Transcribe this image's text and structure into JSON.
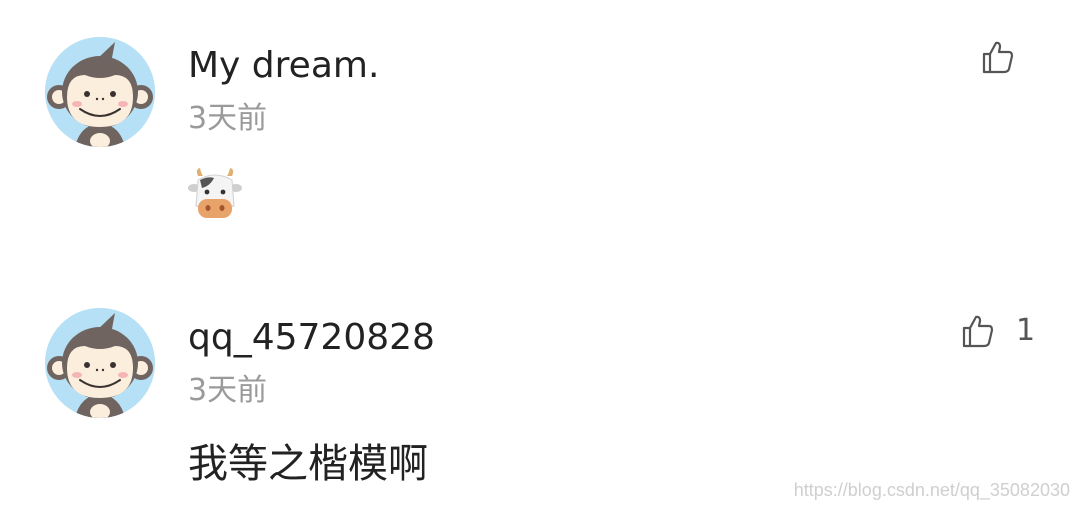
{
  "comments": [
    {
      "username": "My dream.",
      "timestamp": "3天前",
      "content_emoji": "cow-face-emoji",
      "like_icon": "thumbs-up-outline-icon",
      "like_count": ""
    },
    {
      "username": "qq_45720828",
      "timestamp": "3天前",
      "content_text": "我等之楷模啊",
      "like_icon": "thumbs-up-outline-icon",
      "like_count": "1"
    }
  ],
  "watermark": "https://blog.csdn.net/qq_35082030",
  "colors": {
    "avatar_bg": "#b6e0f5",
    "text_primary": "#222222",
    "text_secondary": "#9a9a9a",
    "icon": "#555555"
  }
}
